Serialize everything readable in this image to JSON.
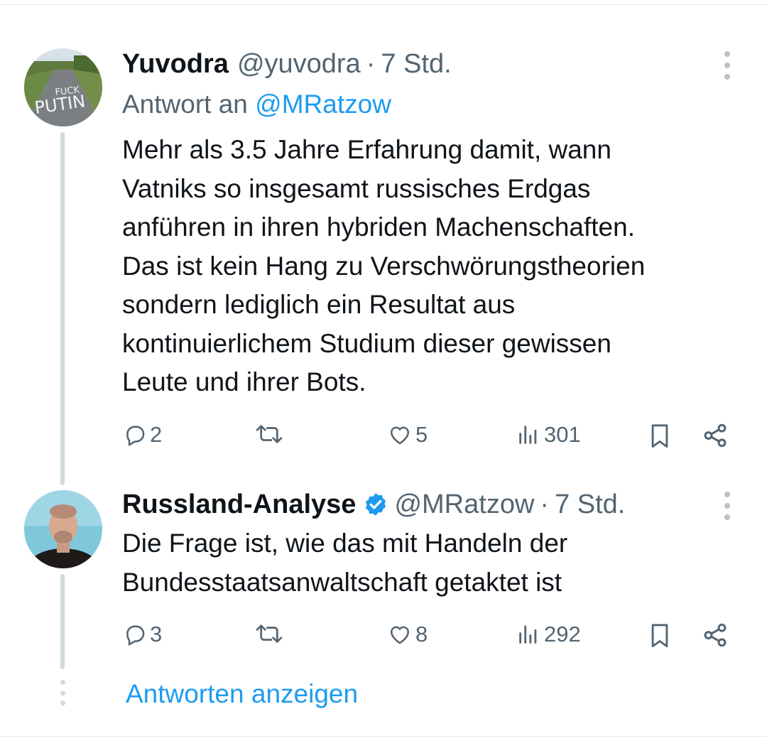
{
  "tweets": [
    {
      "name": "Yuvodra",
      "handle": "@yuvodra",
      "separator": "·",
      "time": "7 Std.",
      "replying_prefix": "Antwort an",
      "replying_to": "@MRatzow",
      "text": "Mehr als 3.5 Jahre Erfahrung damit, wann\nVatniks so insgesamt russisches Erdgas\nanführen in ihren hybriden Machenschaften.\nDas ist kein Hang zu Verschwörungstheorien\nsondern lediglich ein Resultat aus\nkontinuierlichem Studium dieser gewissen\nLeute und ihrer Bots.",
      "avatar_text": [
        "FUCK",
        "PUTIN"
      ],
      "stats": {
        "replies": "2",
        "likes": "5",
        "views": "301"
      }
    },
    {
      "name": "Russland-Analyse",
      "handle": "@MRatzow",
      "separator": "·",
      "time": "7 Std.",
      "verified": true,
      "text": "Die Frage ist, wie das mit Handeln der\nBundesstaatsanwaltschaft getaktet ist",
      "stats": {
        "replies": "3",
        "likes": "8",
        "views": "292"
      }
    }
  ],
  "show_replies_label": "Antworten anzeigen",
  "icons": [
    "reply-icon",
    "retweet-icon",
    "like-icon",
    "views-icon",
    "bookmark-icon",
    "share-icon",
    "more-icon",
    "verified-badge-icon"
  ],
  "colors": {
    "accent": "#1d9bf0",
    "text": "#0f1419",
    "muted": "#536471",
    "thread_line": "#cfd9de"
  }
}
